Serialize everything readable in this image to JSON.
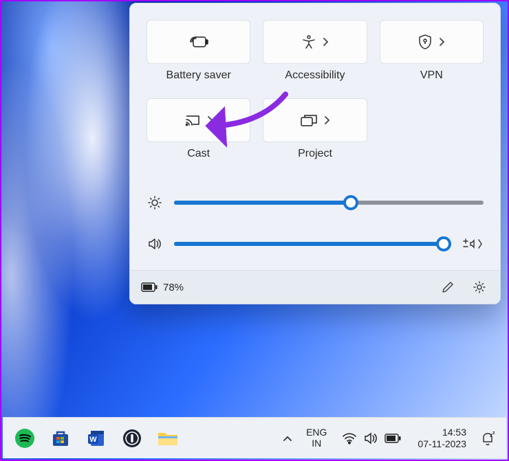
{
  "panel": {
    "tiles": [
      {
        "id": "battery-saver",
        "label": "Battery saver",
        "hasChevron": false
      },
      {
        "id": "accessibility",
        "label": "Accessibility",
        "hasChevron": true
      },
      {
        "id": "vpn",
        "label": "VPN",
        "hasChevron": true
      },
      {
        "id": "cast",
        "label": "Cast",
        "hasChevron": true
      },
      {
        "id": "project",
        "label": "Project",
        "hasChevron": true
      }
    ],
    "brightness": {
      "value": 57
    },
    "volume": {
      "value": 98
    },
    "battery_pct_label": "78%",
    "edit_label": "Edit quick settings",
    "settings_label": "Settings"
  },
  "taskbar": {
    "lang_top": "ENG",
    "lang_bot": "IN",
    "time": "14:53",
    "date": "07-11-2023"
  }
}
